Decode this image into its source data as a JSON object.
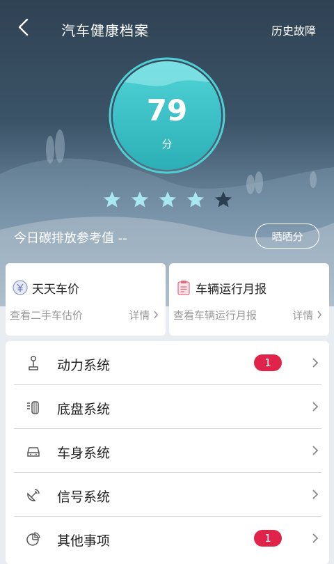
{
  "header": {
    "title": "汽车健康档案",
    "history_label": "历史故障"
  },
  "score": {
    "value": "79",
    "unit": "分",
    "rating_stars": 4,
    "max_stars": 5
  },
  "carbon": {
    "text": "今日碳排放参考值 --"
  },
  "share_label": "晒晒分",
  "cards": [
    {
      "title": "天天车价",
      "subtitle": "查看二手车估价",
      "detail": "详情",
      "icon": "yen-coin-icon"
    },
    {
      "title": "车辆运行月报",
      "subtitle": "查看车辆运行月报",
      "detail": "详情",
      "icon": "clipboard-report-icon"
    }
  ],
  "systems": [
    {
      "label": "动力系统",
      "badge": "1",
      "icon": "gear-shift-icon"
    },
    {
      "label": "底盘系统",
      "badge": "",
      "icon": "tire-icon"
    },
    {
      "label": "车身系统",
      "badge": "",
      "icon": "car-body-icon"
    },
    {
      "label": "信号系统",
      "badge": "",
      "icon": "satellite-dish-icon"
    },
    {
      "label": "其他事项",
      "badge": "1",
      "icon": "pie-chart-icon"
    }
  ],
  "colors": {
    "score_circle": "#3cc4c8",
    "star_active": "#a8e6f0",
    "star_inactive": "#2c3f52",
    "badge": "#e0234a"
  }
}
